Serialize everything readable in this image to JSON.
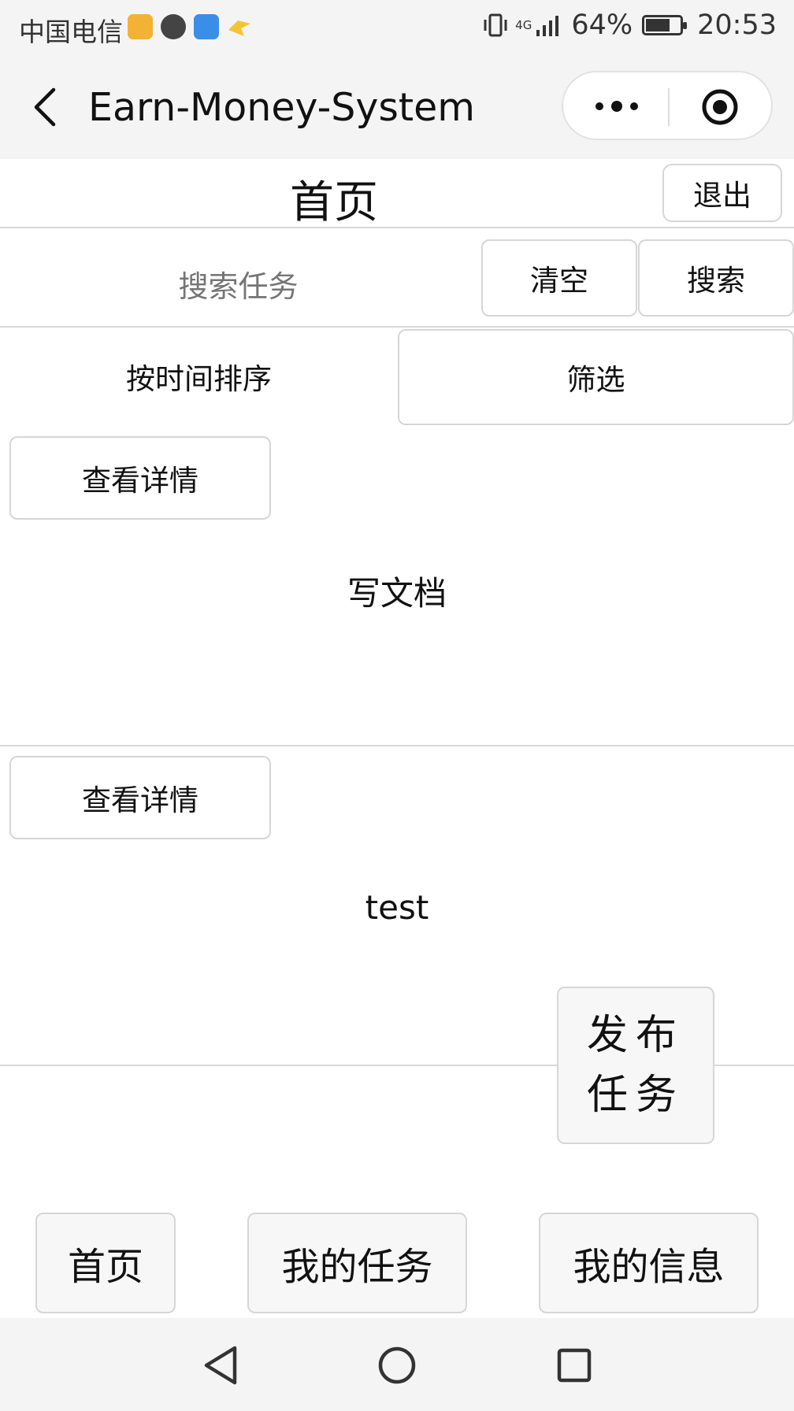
{
  "status_bar": {
    "carrier": "中国电信",
    "network": "4G",
    "battery": "64%",
    "battery_level": 0.64,
    "time": "20:53"
  },
  "navbar": {
    "title": "Earn-Money-System"
  },
  "header": {
    "title": "首页",
    "logout_label": "退出"
  },
  "search": {
    "placeholder": "搜索任务",
    "clear_label": "清空",
    "search_label": "搜索"
  },
  "sort": {
    "sort_by_time_label": "按时间排序",
    "filter_label": "筛选"
  },
  "tasks": [
    {
      "details_label": "查看详情",
      "name": "写文档"
    },
    {
      "details_label": "查看详情",
      "name": "test"
    }
  ],
  "publish_button": {
    "line1": "发布",
    "line2": "任务"
  },
  "tabbar": {
    "home_label": "首页",
    "my_tasks_label": "我的任务",
    "my_info_label": "我的信息"
  }
}
